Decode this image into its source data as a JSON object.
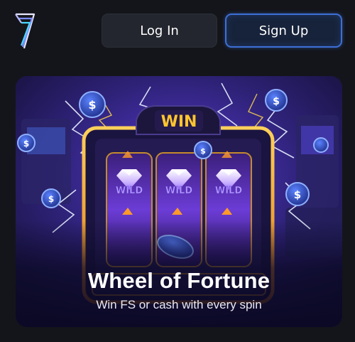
{
  "header": {
    "logo_icon": "seven-logo-icon",
    "login_label": "Log In",
    "signup_label": "Sign Up"
  },
  "banner": {
    "sign_text": "WIN",
    "reel_symbol": "WILD",
    "title": "Wheel of Fortune",
    "subtitle": "Win FS or cash with every spin"
  },
  "colors": {
    "page_bg": "#14151a",
    "button_bg": "#24262f",
    "signup_border": "#3d6fd6",
    "banner_bg": "#1d1547",
    "machine_gold": "#f2a421"
  }
}
